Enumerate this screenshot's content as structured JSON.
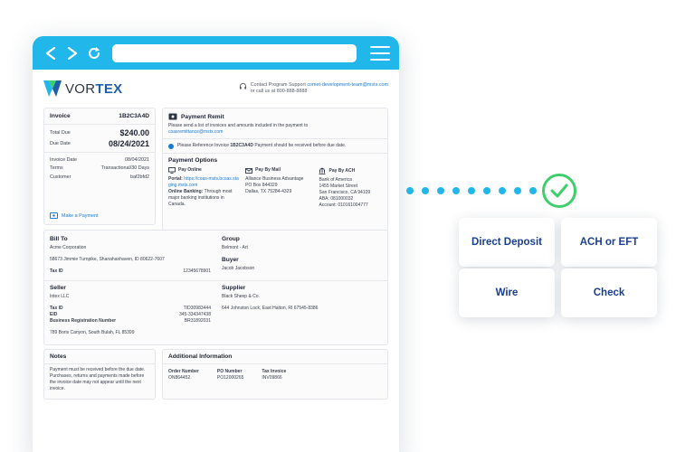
{
  "brand": {
    "logo_prefix": "VOR",
    "logo_suffix": "TEX"
  },
  "support": {
    "line1_prefix": "Contact Program Support ",
    "email": "comet-development-team@msts.com",
    "line2": "or call us at 800-888-8888"
  },
  "invoice": {
    "title": "Invoice",
    "number": "1B2C3A4D",
    "total_due_label": "Total Due",
    "total_due": "$240.00",
    "due_date_label": "Due Date",
    "due_date": "08/24/2021",
    "invoice_date_label": "Invoice Date",
    "invoice_date": "08/04/2021",
    "terms_label": "Terms",
    "terms": "Transactional/30 Days",
    "customer_label": "Customer",
    "customer": "baf2bfd2",
    "make_payment": "Make a Payment"
  },
  "remit": {
    "title": "Payment Remit",
    "desc": "Please send a list of invoices and amounts included in the payment to",
    "email": "coasremittance@msts.com",
    "notice_prefix": "Please Reference Invoice ",
    "notice_invoice": "1B2C3A4D",
    "notice_suffix": "  Payment should be received before due date.",
    "options_title": "Payment Options",
    "online": {
      "title": "Pay Online",
      "portal_label": "Portal: ",
      "portal_url": "https://coas-msts.bcoas.staging.msts.com",
      "banking_label": "Online Banking:",
      "banking_text": " Through most major banking institutions in Canada."
    },
    "mail": {
      "title": "Pay By Mail",
      "lines": [
        "Alliance Business Advantage",
        "PO Box 844329",
        "Dallas, TX 75284-4329"
      ]
    },
    "ach": {
      "title": "Pay By ACH",
      "lines": [
        "Bank of America",
        "1455 Market Street",
        "San Francisco, CA 94109",
        "ABA: 081000032",
        "Account: 010161004777"
      ]
    }
  },
  "bill_to": {
    "title": "Bill To",
    "name": "Acme Corporation",
    "address": "58673 Jimmie Turnpike, Shanahanhaven, ID 80622-7607",
    "tax_id_label": "Tax ID",
    "tax_id": "12345678901"
  },
  "group": {
    "title": "Group",
    "value": "Belmont - Art"
  },
  "buyer": {
    "title": "Buyer",
    "value": "Jacob Jacobson"
  },
  "seller": {
    "title": "Seller",
    "name": "Intex LLC",
    "tax_id_label": "Tax ID",
    "tax_id": "TID30983444",
    "eid_label": "EID",
    "eid": "345-334347438",
    "brn_label": "Business Registration Number",
    "brn": "BR31892031",
    "address": "789 Boris Canyon, South Bulah, FL 85399"
  },
  "supplier": {
    "title": "Supplier",
    "name": "Black Sheep & Co.",
    "address": "644 Johnston Lock, East Halton, RI 67545-8386"
  },
  "notes": {
    "title": "Notes",
    "text": "Payment must be received before the due date. Purchases, returns and payments made before the invoice date may not appear until the next invoice."
  },
  "additional": {
    "title": "Additional Information",
    "columns": [
      {
        "label": "Order Number",
        "value": "ON864452"
      },
      {
        "label": "PO Number",
        "value": "PO12000265"
      },
      {
        "label": "Tax Invoice",
        "value": "INV09866"
      }
    ]
  },
  "methods": [
    "Direct Deposit",
    "ACH or EFT",
    "Wire",
    "Check"
  ],
  "colors": {
    "accent": "#22b7ea",
    "check": "#3ccf6b",
    "method_text": "#1b3f8f"
  }
}
